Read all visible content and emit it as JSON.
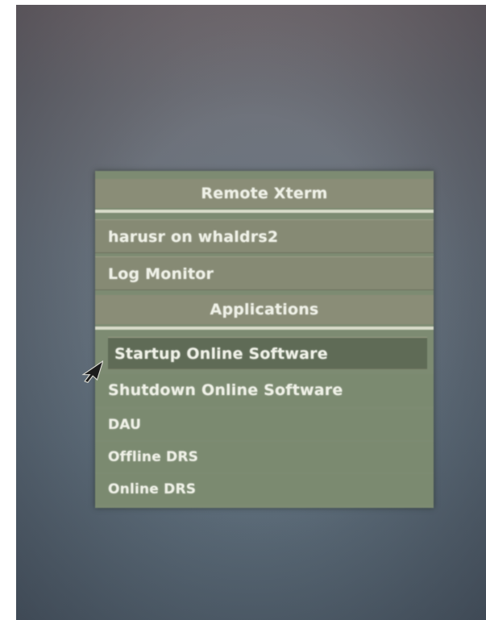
{
  "menu": {
    "title": "Remote Xterm",
    "xterm_items": [
      "harusr on whaldrs2",
      "Log Monitor"
    ],
    "applications_header": "Applications",
    "app_items": [
      "Startup Online Software",
      "Shutdown Online Software",
      "DAU",
      "Offline DRS",
      "Online DRS"
    ],
    "highlighted_item": "Startup Online Software"
  },
  "colors": {
    "menu_background": "#7d8b72",
    "highlight": "#5f6b56",
    "text": "#eef0e6",
    "desktop": "#5e6d7a"
  },
  "icons": {
    "pointer": "arrow-cursor-icon"
  }
}
